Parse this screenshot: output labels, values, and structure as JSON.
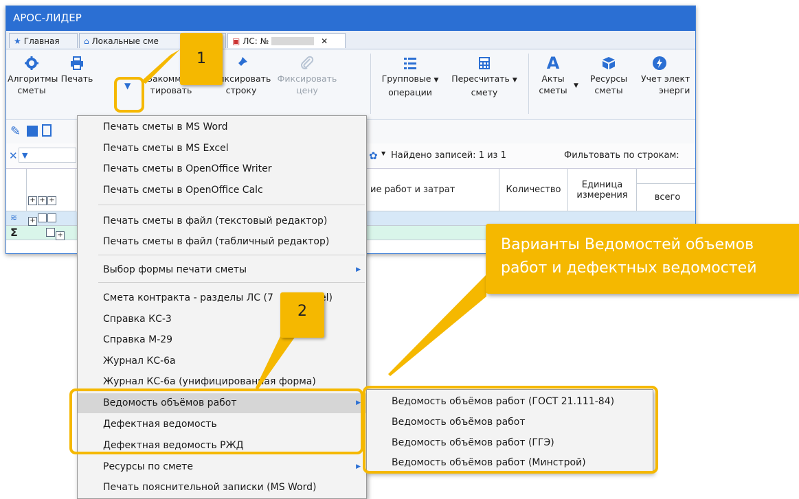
{
  "window": {
    "title": "АРОС-ЛИДЕР",
    "tabs": [
      {
        "label": "Главная",
        "icon": "star-icon"
      },
      {
        "label": "Локальные сме",
        "icon": "home-icon"
      },
      {
        "label": "ЛС: №",
        "icon": "document-icon",
        "close": "✕"
      }
    ]
  },
  "ribbon": {
    "algorithms": {
      "line1": "Алгоритмы",
      "line2": "сметы"
    },
    "print": {
      "line1": "Печать",
      "line2": ""
    },
    "comment": {
      "line1": "Закоммен-",
      "line2": "тировать"
    },
    "fix_row": {
      "line1": "Фиксировать",
      "line2": "строку"
    },
    "fix_price": {
      "line1": "Фиксировать",
      "line2": "цену"
    },
    "group_ops": {
      "line1": "Групповые",
      "line2": "операции"
    },
    "recalc": {
      "line1": "Пересчитать",
      "line2": "смету"
    },
    "acts": {
      "line1": "Акты",
      "line2": "сметы"
    },
    "resources": {
      "line1": "Ресурсы",
      "line2": "сметы"
    },
    "energy": {
      "line1": "Учет элект",
      "line2": "энерги"
    }
  },
  "filterbar": {
    "found": "Найдено записей: 1 из 1",
    "filter_rows": "Фильтовать по строкам:"
  },
  "grid": {
    "col_name": "ие работ и затрат",
    "col_qty": "Количество",
    "col_unit": "Единица измерения",
    "col_total": "всего"
  },
  "menu": {
    "items": [
      "Печать сметы в MS Word",
      "Печать сметы в MS Excel",
      "Печать сметы в OpenOffice Writer",
      "Печать сметы в OpenOffice Calc",
      "Печать сметы в файл (текстовый редактор)",
      "Печать сметы в файл (табличный редактор)",
      "Выбор формы печати сметы",
      "Смета контракта - разделы ЛС (7",
      "el)",
      "Справка КС-3",
      "Справка М-29",
      "Журнал КС-6а",
      "Журнал КС-6а (унифицированная форма)",
      "Ведомость объёмов работ",
      "Дефектная ведомость",
      "Дефектная ведомость РЖД",
      "Ресурсы по смете",
      "Печать пояснительной записки (MS Word)"
    ]
  },
  "submenu": {
    "items": [
      "Ведомость объёмов работ (ГОСТ 21.111-84)",
      "Ведомость объёмов работ",
      "Ведомость объёмов работ (ГГЭ)",
      "Ведомость объёмов работ (Минстрой)"
    ]
  },
  "annotations": {
    "badge1": "1",
    "badge2": "2",
    "callout_line1": "Варианты Ведомостей объемов",
    "callout_line2": "работ и дефектных ведомостей"
  },
  "colors": {
    "accent": "#2b6fd3",
    "highlight": "#f5b800",
    "grid_row_selected": "#d7e8f7",
    "grid_row_total": "#d9f5ea"
  }
}
